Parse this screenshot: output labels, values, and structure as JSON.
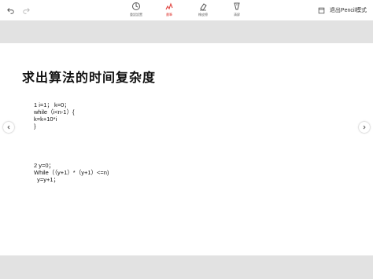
{
  "toolbar": {
    "tools": [
      {
        "label": "重設設置",
        "icon": "reset-icon"
      },
      {
        "label": "畫筆",
        "icon": "pen-icon"
      },
      {
        "label": "橡皮擦",
        "icon": "eraser-icon"
      },
      {
        "label": "清屏",
        "icon": "clear-icon"
      }
    ],
    "exit_label": "退出Pencil模式"
  },
  "slide": {
    "title": "求出算法的时间复杂度",
    "block1": [
      "1 i=1； k=0；",
      "while（i<n-1）{",
      "k=k+10*i",
      "}"
    ],
    "block2": [
      "2 y=0；",
      "While（（y+1）*（y+1）<=n)",
      "  y=y+1；"
    ]
  },
  "colors": {
    "accent": "#e0403c",
    "band": "#e2e2e2"
  }
}
